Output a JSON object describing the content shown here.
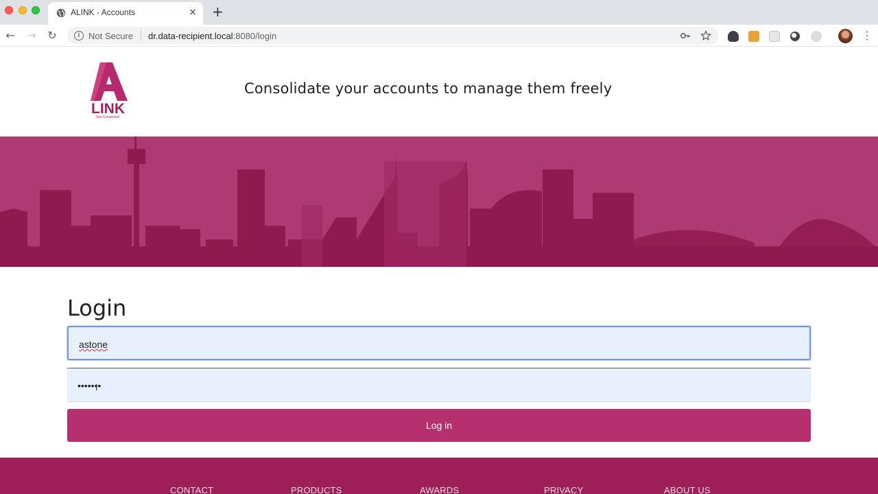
{
  "browser": {
    "tab_title": "ALINK - Accounts",
    "tab_close": "×",
    "new_tab": "+",
    "security_label": "Not Secure",
    "url_host": "dr.data-recipient.local",
    "url_rest": ":8080/login",
    "icons": {
      "back": "back-arrow-icon",
      "forward": "forward-arrow-icon",
      "reload": "reload-icon",
      "info": "info-icon",
      "key": "key-icon",
      "star": "star-icon",
      "menu": "kebab-menu-icon"
    }
  },
  "header": {
    "logo_text": "LINK",
    "logo_tagline": "Get Connected",
    "tagline": "Consolidate your accounts to manage them freely"
  },
  "login": {
    "title": "Login",
    "username_value": "astone",
    "password_value": "•••••••",
    "submit_label": "Log in"
  },
  "footer": {
    "links": [
      "CONTACT",
      "PRODUCTS",
      "AWARDS",
      "PRIVACY",
      "ABOUT US"
    ]
  },
  "colors": {
    "brand": "#b6306f",
    "banner": "#ad3a73",
    "skyline": "#8f1a4f",
    "footer": "#9d1f57",
    "autofill": "#e8f0fe"
  }
}
